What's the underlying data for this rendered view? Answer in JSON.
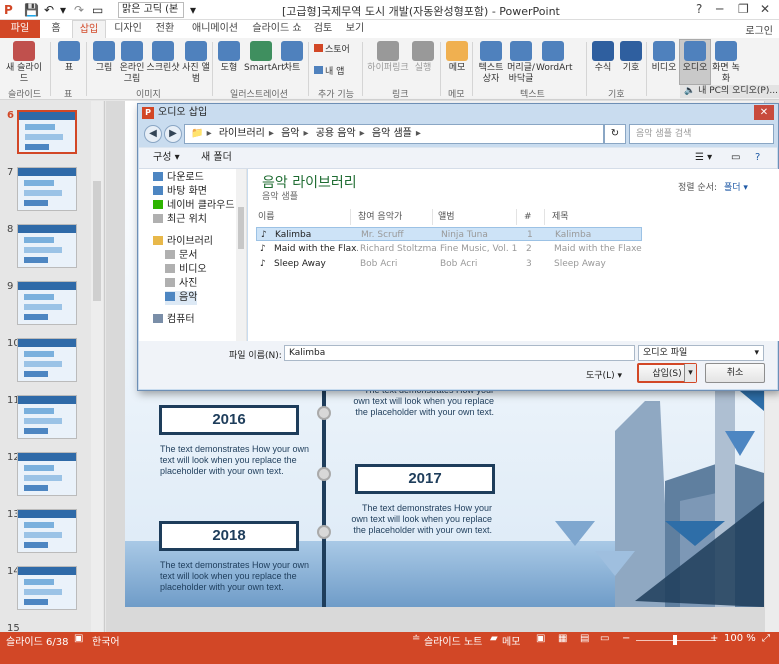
{
  "titlebar": {
    "font_value": "맑은 고딕 (본",
    "title": "[고급형]국제무역 도시 개발(자동완성형포함) - PowerPoint",
    "help": "?",
    "minimize": "─",
    "restore": "❐",
    "close": "✕"
  },
  "tabs": [
    "파일",
    "홈",
    "삽입",
    "디자인",
    "전환",
    "애니메이션",
    "슬라이드 쇼",
    "검토",
    "보기"
  ],
  "user": "로그인",
  "ribbon": {
    "buttons": [
      {
        "label": "새 슬라이드",
        "color": "#c0504d"
      },
      {
        "label": "표",
        "color": "#4f81bd"
      },
      {
        "label": "그림",
        "color": "#4f81bd"
      },
      {
        "label": "온라인 그림",
        "color": "#4f81bd"
      },
      {
        "label": "스크린샷",
        "color": "#4f81bd"
      },
      {
        "label": "사진 앨범",
        "color": "#4f81bd"
      },
      {
        "label": "도형",
        "color": "#4f81bd"
      },
      {
        "label": "SmartArt",
        "color": "#3f8f5f"
      },
      {
        "label": "차트",
        "color": "#4f81bd"
      },
      {
        "label": "스토어",
        "color": "#d24726"
      },
      {
        "label": "내 앱",
        "color": "#4f81bd"
      },
      {
        "label": "하이퍼링크",
        "color": "#999999"
      },
      {
        "label": "실행",
        "color": "#999999"
      },
      {
        "label": "메모",
        "color": "#f0b050"
      },
      {
        "label": "텍스트 상자",
        "color": "#4f81bd"
      },
      {
        "label": "머리글/바닥글",
        "color": "#4f81bd"
      },
      {
        "label": "WordArt",
        "color": "#4f81bd"
      },
      {
        "label": "수식",
        "color": "#2f5f9f"
      },
      {
        "label": "기호",
        "color": "#2f5f9f"
      },
      {
        "label": "비디오",
        "color": "#4f81bd"
      },
      {
        "label": "오디오",
        "color": "#4f81bd"
      },
      {
        "label": "화면 녹화",
        "color": "#4f81bd"
      }
    ],
    "groups": [
      "슬라이드",
      "표",
      "이미지",
      "일러스트레이션",
      "추가 기능",
      "링크",
      "메모",
      "텍스트",
      "기호"
    ],
    "pc_audio": "내 PC의 오디오(P)..."
  },
  "thumbnails": [
    {
      "num": "6",
      "selected": true
    },
    {
      "num": "7",
      "selected": false
    },
    {
      "num": "8",
      "selected": false
    },
    {
      "num": "9",
      "selected": false
    },
    {
      "num": "10",
      "selected": false
    },
    {
      "num": "11",
      "selected": false
    },
    {
      "num": "12",
      "selected": false
    },
    {
      "num": "13",
      "selected": false
    },
    {
      "num": "14",
      "selected": false
    },
    {
      "num": "15",
      "selected": false
    }
  ],
  "slide": {
    "years": [
      "2016",
      "2017",
      "2018"
    ],
    "body": "The text demonstrates How your own text will look when you replace the placeholder with your own text.",
    "colors": {
      "navy": "#1e3d5b",
      "accent": "#2e6ea8",
      "sky": "#cfe2f3"
    }
  },
  "dialog": {
    "title": "오디오 삽입",
    "address": [
      "라이브러리",
      "음악",
      "공용 음악",
      "음악 샘플"
    ],
    "search_placeholder": "음악 샘플 검색",
    "toolbar": {
      "organize": "구성 ▾",
      "new_folder": "새 폴더"
    },
    "tree": [
      {
        "label": "다운로드",
        "child": false,
        "selected": false,
        "icon": "#4d86c2"
      },
      {
        "label": "바탕 화면",
        "child": false,
        "selected": false,
        "icon": "#4d86c2"
      },
      {
        "label": "네이버 클라우드",
        "child": false,
        "selected": false,
        "icon": "#2db400"
      },
      {
        "label": "최근 위치",
        "child": false,
        "selected": false,
        "icon": "#b0b0b0"
      },
      {
        "label": "라이브러리",
        "child": false,
        "selected": false,
        "icon": "#e8b84a"
      },
      {
        "label": "문서",
        "child": true,
        "selected": false,
        "icon": "#b0b0b0"
      },
      {
        "label": "비디오",
        "child": true,
        "selected": false,
        "icon": "#b0b0b0"
      },
      {
        "label": "사진",
        "child": true,
        "selected": false,
        "icon": "#b0b0b0"
      },
      {
        "label": "음악",
        "child": true,
        "selected": true,
        "icon": "#4d86c2"
      },
      {
        "label": "컴퓨터",
        "child": false,
        "selected": false,
        "icon": "#7a8ea8"
      }
    ],
    "library_title": "음악 라이브러리",
    "library_sub": "음악 샘플",
    "sort_label": "정렬 순서:",
    "sort_value": "폴더 ▾",
    "columns": [
      "이름",
      "참여 음악가",
      "앨범",
      "#",
      "제목"
    ],
    "files": [
      {
        "name": "Kalimba",
        "artist": "Mr. Scruff",
        "album": "Ninja Tuna",
        "num": "1",
        "title": "Kalimba",
        "selected": true
      },
      {
        "name": "Maid with the Flax...",
        "artist": "Richard Stoltzma...",
        "album": "Fine Music, Vol. 1",
        "num": "2",
        "title": "Maid with the Flaxen ...",
        "selected": false
      },
      {
        "name": "Sleep Away",
        "artist": "Bob Acri",
        "album": "Bob Acri",
        "num": "3",
        "title": "Sleep Away",
        "selected": false
      }
    ],
    "filename_label": "파일 이름(N):",
    "filename_value": "Kalimba",
    "filetype_value": "오디오 파일",
    "tools_label": "도구(L) ▾",
    "insert_label": "삽입(S)",
    "cancel_label": "취소"
  },
  "statusbar": {
    "slide_info": "슬라이드 6/38",
    "language": "한국어",
    "notes": "슬라이드 노트",
    "comments": "메모",
    "zoom": "100 %"
  }
}
